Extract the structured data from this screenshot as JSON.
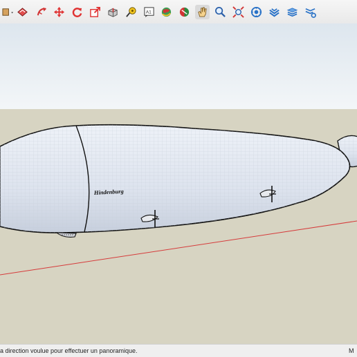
{
  "toolbar": {
    "tools": [
      {
        "id": "paint-bucket",
        "label": "Paint Bucket"
      },
      {
        "id": "eraser",
        "label": "Eraser"
      },
      {
        "id": "follow-me",
        "label": "Follow Me"
      },
      {
        "id": "move",
        "label": "Move"
      },
      {
        "id": "rotate",
        "label": "Rotate"
      },
      {
        "id": "scale",
        "label": "Scale"
      },
      {
        "id": "push-pull",
        "label": "Push/Pull"
      },
      {
        "id": "tape-measure",
        "label": "Tape Measure"
      },
      {
        "id": "text",
        "label": "Text",
        "glyph": "A1"
      },
      {
        "id": "orbit",
        "label": "Orbit"
      },
      {
        "id": "section-plane",
        "label": "Section Plane"
      },
      {
        "id": "pan",
        "label": "Pan",
        "active": true
      },
      {
        "id": "zoom",
        "label": "Zoom"
      },
      {
        "id": "zoom-extents",
        "label": "Zoom Extents"
      },
      {
        "id": "warehouse",
        "label": "3D Warehouse"
      },
      {
        "id": "extension-1",
        "label": "Extension"
      },
      {
        "id": "extension-2",
        "label": "Extension"
      },
      {
        "id": "extension-3",
        "label": "Extension"
      }
    ]
  },
  "model": {
    "hull_text": "Hindenburg",
    "colors": {
      "sky": "#e7eef4",
      "ground": "#d7d4c2",
      "hull": "#dde3ee",
      "axis": "#d63a3a"
    }
  },
  "status": {
    "hint": "la direction voulue pour effectuer un panoramique.",
    "right": "M"
  }
}
